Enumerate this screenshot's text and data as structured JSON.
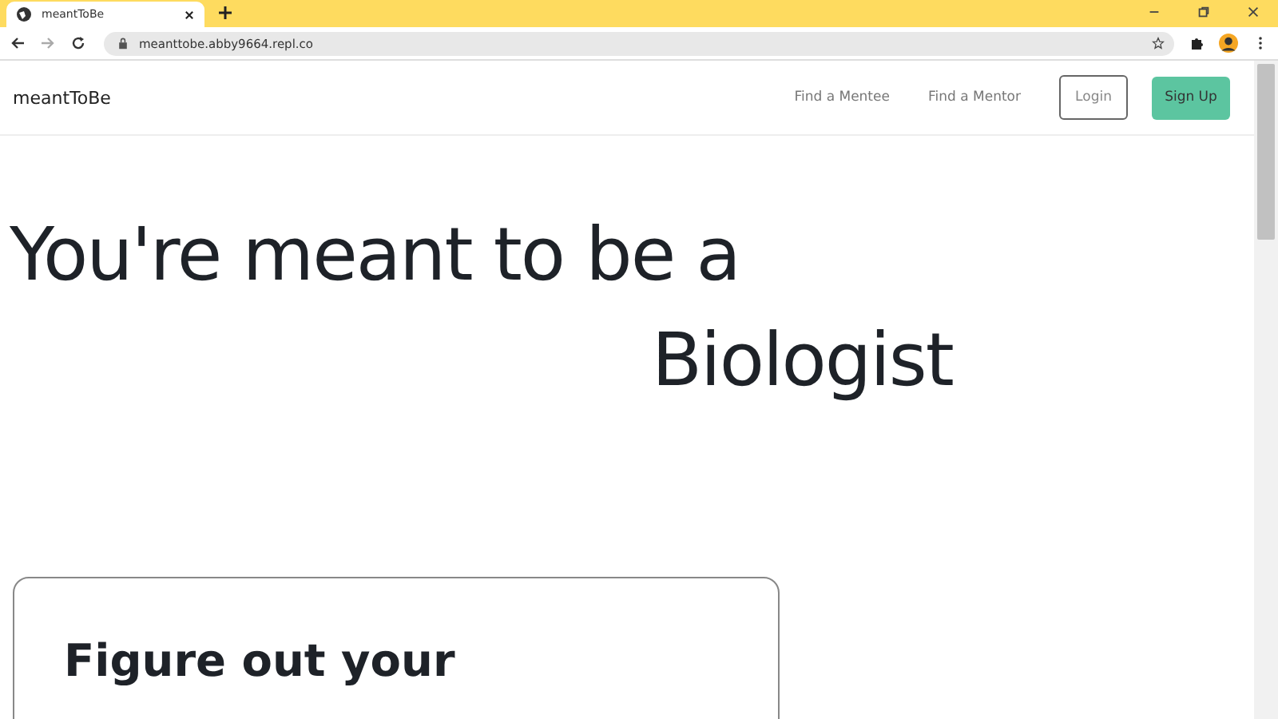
{
  "browser": {
    "tab_title": "meantToBe",
    "url": "meanttobe.abby9664.repl.co"
  },
  "navbar": {
    "brand": "meantToBe",
    "links": [
      "Find a Mentee",
      "Find a Mentor"
    ],
    "login": "Login",
    "signup": "Sign Up"
  },
  "hero": {
    "line1": "You're meant to be a",
    "line2": "Biologist"
  },
  "card": {
    "heading": "Figure out your"
  }
}
